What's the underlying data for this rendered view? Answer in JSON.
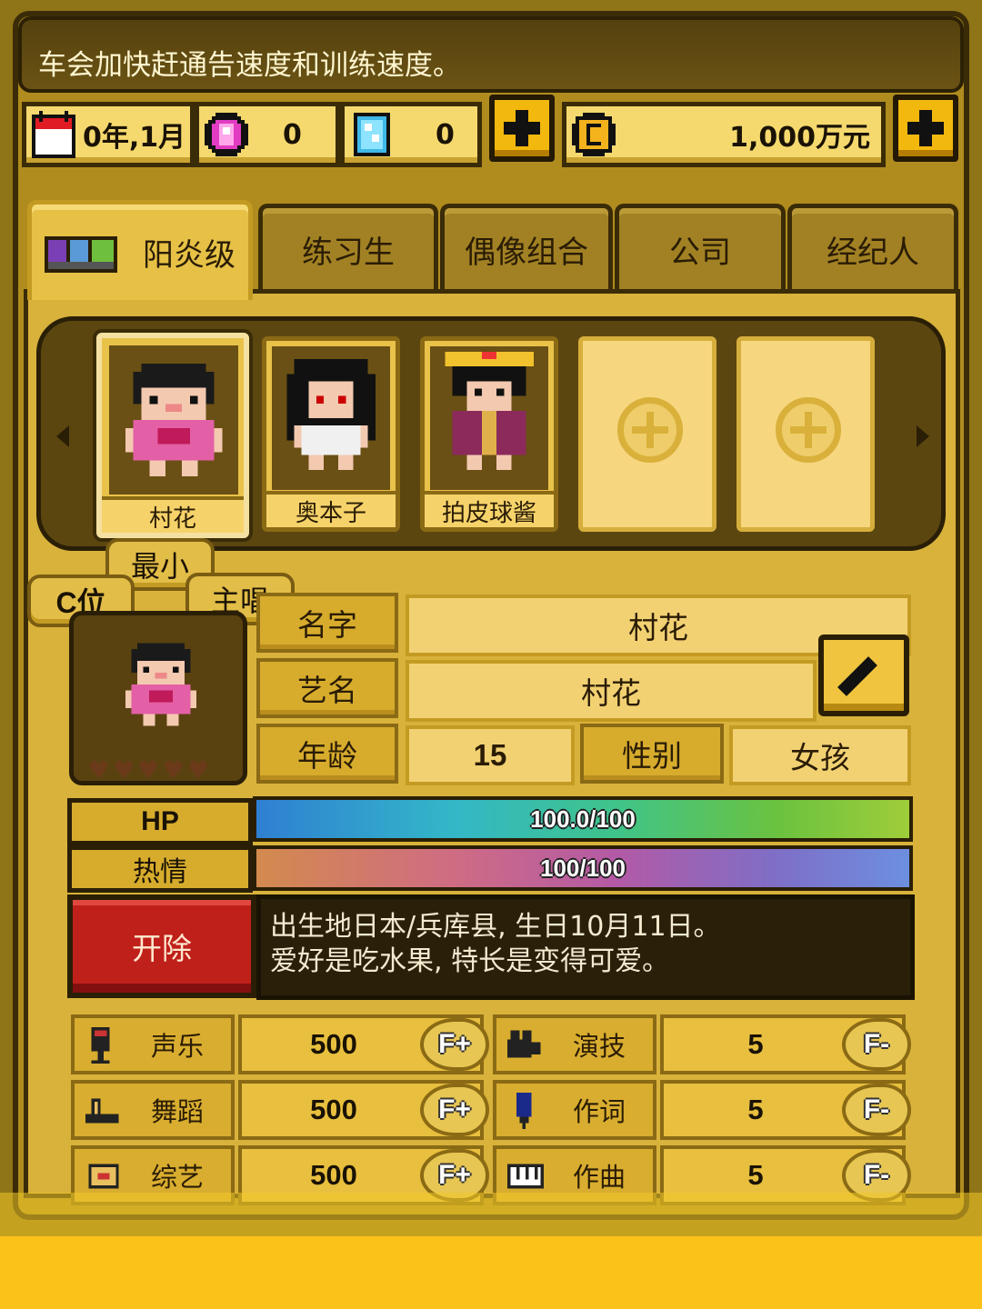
{
  "tip": "车会加快赶通告速度和训练速度。",
  "resources": {
    "date": "0年,1月",
    "pink_gem": "0",
    "blue_gem": "0",
    "money": "1,000万元"
  },
  "tabs": [
    "阳炎级",
    "练习生",
    "偶像组合",
    "公司",
    "经纪人"
  ],
  "roster": [
    {
      "name": "村花"
    },
    {
      "name": "奥本子"
    },
    {
      "name": "拍皮球酱"
    }
  ],
  "tags": {
    "youngest": "最小",
    "center": "C位",
    "vocal": "主唱"
  },
  "profile": {
    "name_label": "名字",
    "name_value": "村花",
    "stage_label": "艺名",
    "stage_value": "村花",
    "age_label": "年龄",
    "age_value": "15",
    "gender_label": "性别",
    "gender_value": "女孩",
    "hearts": 5
  },
  "bars": {
    "hp_label": "HP",
    "hp_text": "100.0/100",
    "hp_fraction": 1.0,
    "passion_label": "热情",
    "passion_text": "100/100",
    "passion_fraction": 1.0
  },
  "fire_label": "开除",
  "bio": [
    "出生地日本/兵库县, 生日10月11日。",
    "爱好是吃水果, 特长是变得可爱。"
  ],
  "skills": [
    {
      "name": "声乐",
      "value": "500",
      "grade": "F+",
      "icon": "microphone-icon"
    },
    {
      "name": "演技",
      "value": "5",
      "grade": "F-",
      "icon": "camera-icon"
    },
    {
      "name": "舞蹈",
      "value": "500",
      "grade": "F+",
      "icon": "shoe-icon"
    },
    {
      "name": "作词",
      "value": "5",
      "grade": "F-",
      "icon": "pen-icon"
    },
    {
      "name": "综艺",
      "value": "500",
      "grade": "F+",
      "icon": "variety-icon"
    },
    {
      "name": "作曲",
      "value": "5",
      "grade": "F-",
      "icon": "piano-icon"
    }
  ],
  "colors": {
    "gold": "#d8b23b",
    "dark": "#3b2c08",
    "fire": "#c0201a"
  }
}
